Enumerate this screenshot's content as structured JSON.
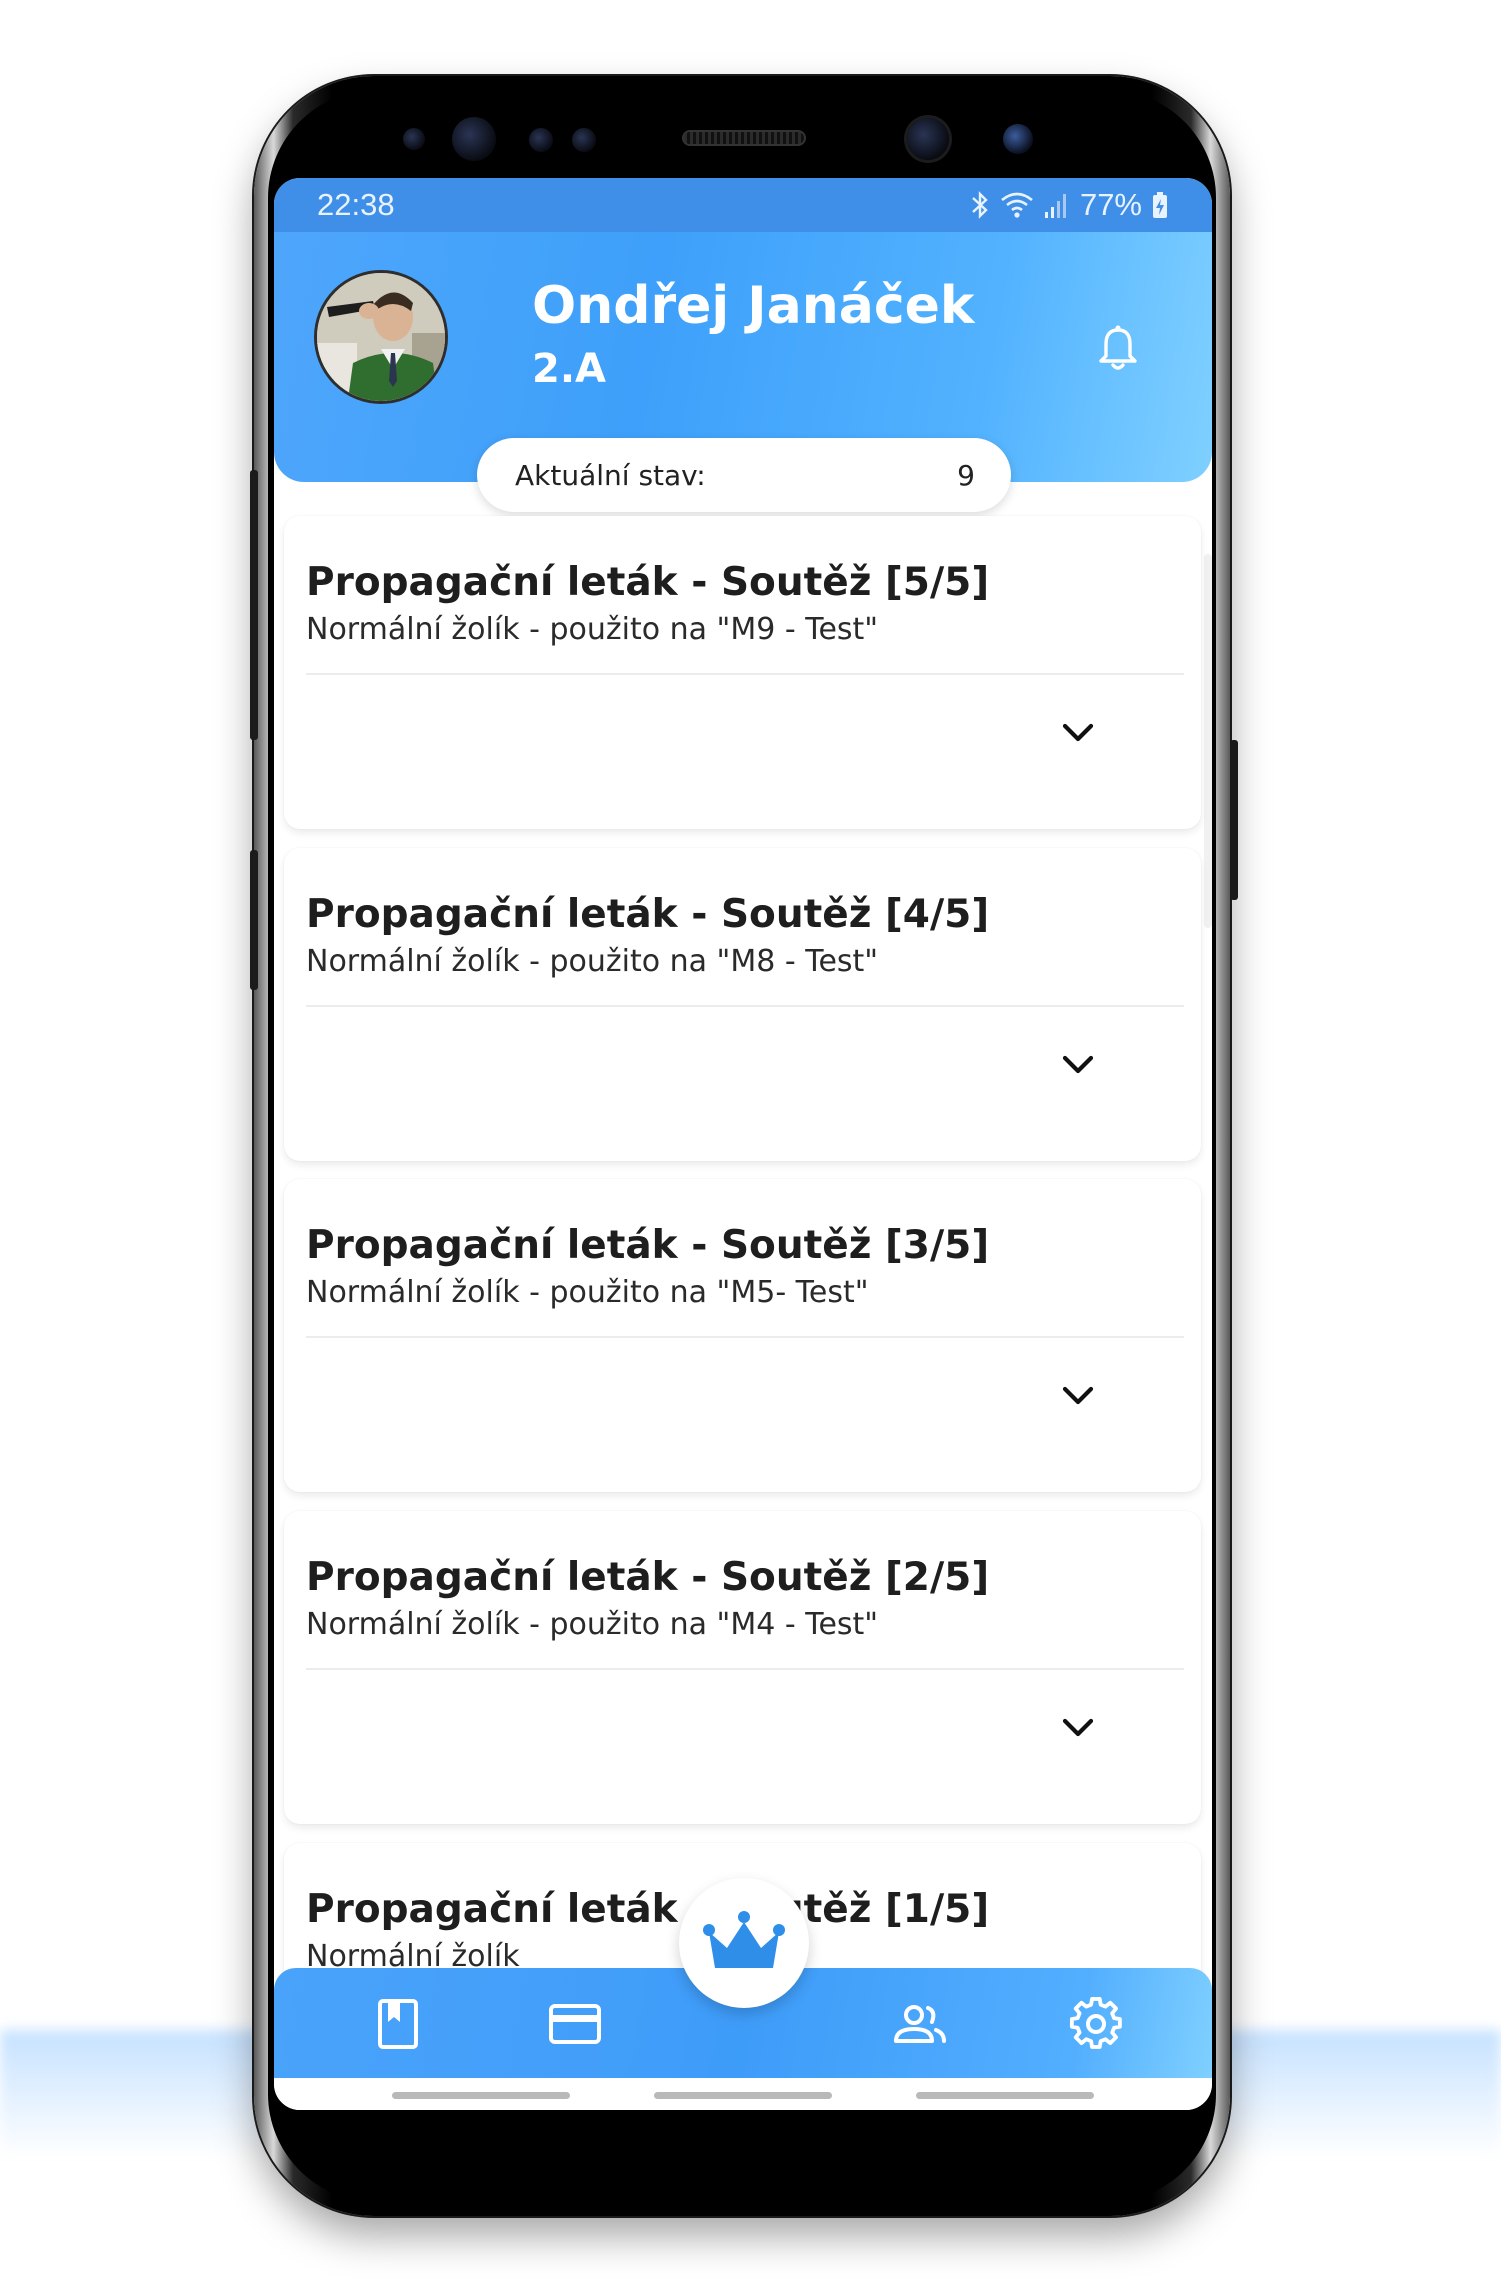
{
  "status_bar": {
    "time": "22:38",
    "battery": "77%",
    "icons": [
      "bluetooth-icon",
      "wifi-icon",
      "signal-icon",
      "battery-charging-icon"
    ]
  },
  "header": {
    "name": "Ondřej Janáček",
    "class_name": "2.A",
    "icons": [
      "avatar",
      "bell-icon"
    ]
  },
  "balance": {
    "label": "Aktuální stav:",
    "value": "9"
  },
  "cards": [
    {
      "title": "Propagační leták - Soutěž [5/5]",
      "subtitle": "Normální žolík - použito na \"M9 - Test\""
    },
    {
      "title": "Propagační leták - Soutěž [4/5]",
      "subtitle": "Normální žolík - použito na \"M8 - Test\""
    },
    {
      "title": "Propagační leták - Soutěž [3/5]",
      "subtitle": "Normální žolík - použito na \"M5- Test\""
    },
    {
      "title": "Propagační leták - Soutěž [2/5]",
      "subtitle": "Normální žolík - použito na \"M4 - Test\""
    },
    {
      "title": "Propagační leták - Soutěž [1/5]",
      "subtitle": "Normální žolík"
    }
  ],
  "bottom_nav": {
    "items": [
      "book-icon",
      "card-icon",
      "crown-icon",
      "people-icon",
      "gear-icon"
    ],
    "active": "crown-icon"
  },
  "colors": {
    "accent": "#3e9cf9",
    "status_bar": "#3f8fe9",
    "card_bg": "#ffffff",
    "text": "#1e1e1e"
  }
}
